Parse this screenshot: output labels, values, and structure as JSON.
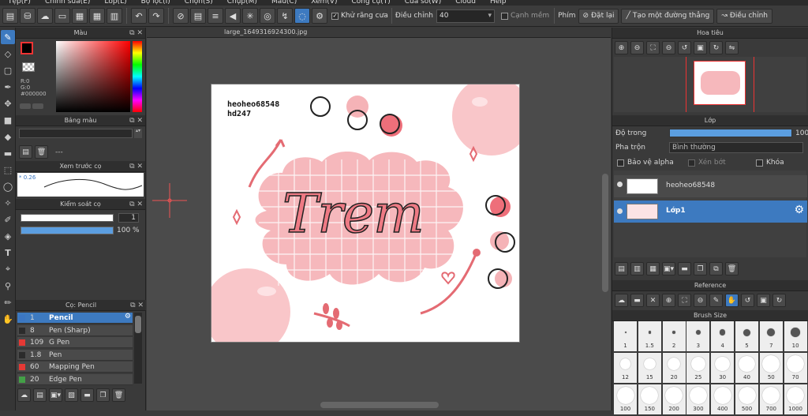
{
  "menu": [
    "Tệp(F)",
    "Chỉnh sửa(E)",
    "Lớp(L)",
    "Bộ lọc(I)",
    "Chọn(S)",
    "Chụp(M)",
    "Màu(C)",
    "Xem(V)",
    "Công cụ(T)",
    "Cửa sổ(W)",
    "Cloud",
    "Help"
  ],
  "toolbar": {
    "antialias_label": "Khử răng cưa",
    "adjust_label": "Điều chỉnh",
    "adjust_value": "40",
    "edge_label": "Cạnh mềm",
    "key_label": "Phím",
    "reset_label": "Đặt lại",
    "straight_label": "Tạo một đường thẳng",
    "adjust_btn_label": "Điều chỉnh"
  },
  "color_panel": {
    "title": "Màu",
    "r": "R:0",
    "g": "G:0",
    "b": "B:0",
    "hex": "#000000",
    "primary": "#000000",
    "secondary": "#ffffff",
    "hue": "#ff0000"
  },
  "palette_panel": {
    "title": "Bảng màu",
    "set_name": "---"
  },
  "brush_preview": {
    "title": "Xem trước cọ",
    "value": "* 0.26"
  },
  "brush_control": {
    "title": "Kiểm soát cọ",
    "size": "1",
    "opacity": "100 %"
  },
  "brush_list": {
    "title": "Cọ: Pencil",
    "items": [
      {
        "size": "1",
        "name": "Pencil",
        "color": "#3b76c2"
      },
      {
        "size": "8",
        "name": "Pen (Sharp)",
        "color": "#2b2b2b"
      },
      {
        "size": "109",
        "name": "G Pen",
        "color": "#e53935"
      },
      {
        "size": "1.8",
        "name": "Pen",
        "color": "#2b2b2b"
      },
      {
        "size": "60",
        "name": "Mapping Pen",
        "color": "#e53935"
      },
      {
        "size": "20",
        "name": "Edge Pen",
        "color": "#43a047"
      }
    ]
  },
  "document": {
    "filename": "large_1649316924300.jpg",
    "credit_line1": "heoheo68548",
    "credit_line2": "hd247",
    "art_text": "Trem"
  },
  "navigator": {
    "title": "Hoa tiêu"
  },
  "layer_panel": {
    "title": "Lớp",
    "opacity_label": "Độ trong",
    "opacity_value": "100",
    "blend_label": "Pha trộn",
    "blend_value": "Bình thường",
    "protect_alpha": "Bảo vệ alpha",
    "clipping": "Xén bớt",
    "lock": "Khóa",
    "layers": [
      {
        "name": "heoheo68548"
      },
      {
        "name": "Lớp1"
      }
    ]
  },
  "reference_panel": {
    "title": "Reference"
  },
  "brush_size_panel": {
    "title": "Brush Size",
    "sizes": [
      "1",
      "1.5",
      "2",
      "3",
      "4",
      "5",
      "7",
      "10",
      "12",
      "15",
      "20",
      "25",
      "30",
      "40",
      "50",
      "70",
      "100",
      "150",
      "200",
      "300",
      "400",
      "500",
      "700",
      "1000"
    ]
  }
}
